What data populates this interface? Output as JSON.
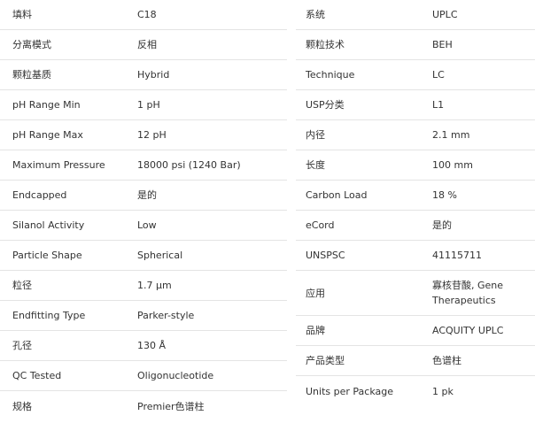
{
  "left_specs": [
    {
      "label": "填料",
      "value": "C18"
    },
    {
      "label": "分离模式",
      "value": "反相"
    },
    {
      "label": "颗粒基质",
      "value": "Hybrid"
    },
    {
      "label": "pH Range Min",
      "value": "1 pH"
    },
    {
      "label": "pH Range Max",
      "value": "12 pH"
    },
    {
      "label": "Maximum Pressure",
      "value": "18000 psi (1240 Bar)"
    },
    {
      "label": "Endcapped",
      "value": "是的"
    },
    {
      "label": "Silanol Activity",
      "value": "Low"
    },
    {
      "label": "Particle Shape",
      "value": "Spherical"
    },
    {
      "label": "粒径",
      "value": "1.7 µm"
    },
    {
      "label": "Endfitting Type",
      "value": "Parker-style"
    },
    {
      "label": "孔径",
      "value": "130 Å"
    },
    {
      "label": "QC Tested",
      "value": "Oligonucleotide"
    },
    {
      "label": "规格",
      "value": "Premier色谱柱"
    }
  ],
  "right_specs": [
    {
      "label": "系统",
      "value": "UPLC"
    },
    {
      "label": "颗粒技术",
      "value": "BEH"
    },
    {
      "label": "Technique",
      "value": "LC"
    },
    {
      "label": "USP分类",
      "value": "L1"
    },
    {
      "label": "内径",
      "value": "2.1 mm"
    },
    {
      "label": "长度",
      "value": "100 mm"
    },
    {
      "label": "Carbon Load",
      "value": "18 %"
    },
    {
      "label": "eCord",
      "value": "是的"
    },
    {
      "label": "UNSPSC",
      "value": "41115711"
    },
    {
      "label": "应用",
      "value": "寡核苷酸, Gene Therapeutics"
    },
    {
      "label": "品牌",
      "value": "ACQUITY UPLC"
    },
    {
      "label": "产品类型",
      "value": "色谱柱"
    },
    {
      "label": "Units per Package",
      "value": "1 pk"
    }
  ]
}
